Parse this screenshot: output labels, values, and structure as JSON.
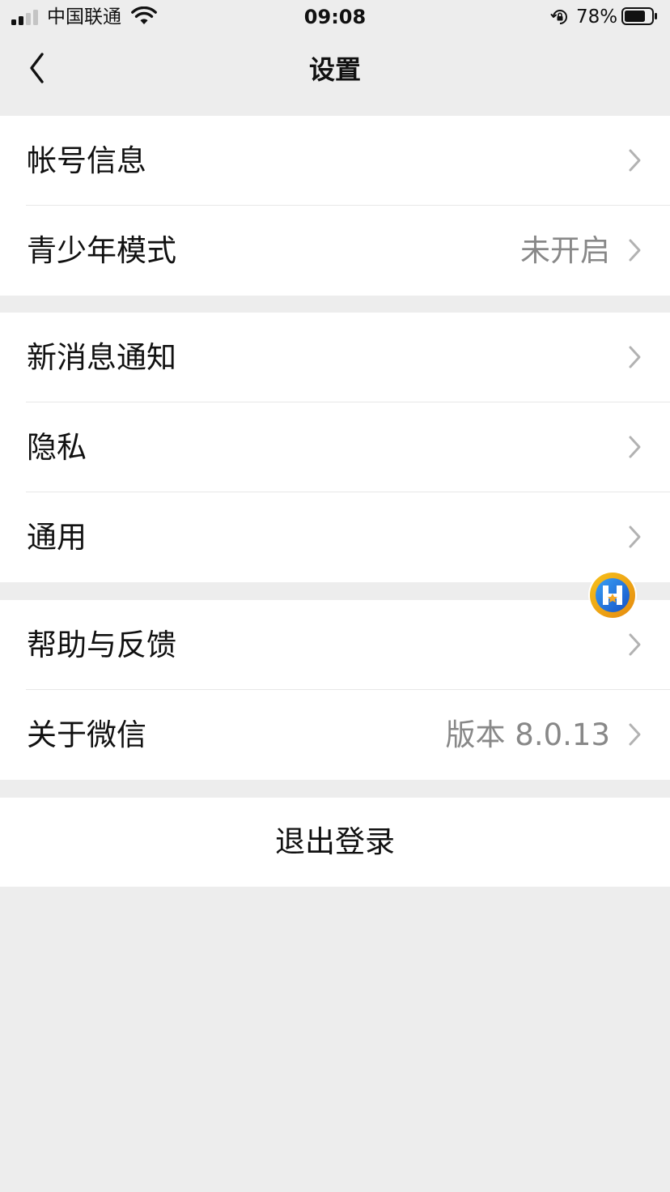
{
  "status_bar": {
    "carrier": "中国联通",
    "time": "09:08",
    "battery_percent": "78%",
    "battery_level": 0.78
  },
  "nav": {
    "title": "设置"
  },
  "groups": [
    {
      "rows": [
        {
          "label": "帐号信息",
          "value": ""
        },
        {
          "label": "青少年模式",
          "value": "未开启"
        }
      ]
    },
    {
      "rows": [
        {
          "label": "新消息通知",
          "value": ""
        },
        {
          "label": "隐私",
          "value": ""
        },
        {
          "label": "通用",
          "value": ""
        }
      ]
    },
    {
      "rows": [
        {
          "label": "帮助与反馈",
          "value": ""
        },
        {
          "label": "关于微信",
          "value": "版本 8.0.13"
        }
      ]
    }
  ],
  "logout": {
    "label": "退出登录"
  },
  "colors": {
    "background": "#ededed",
    "row_bg": "#ffffff",
    "secondary_text": "#888888",
    "chevron": "#b2b2b2"
  }
}
